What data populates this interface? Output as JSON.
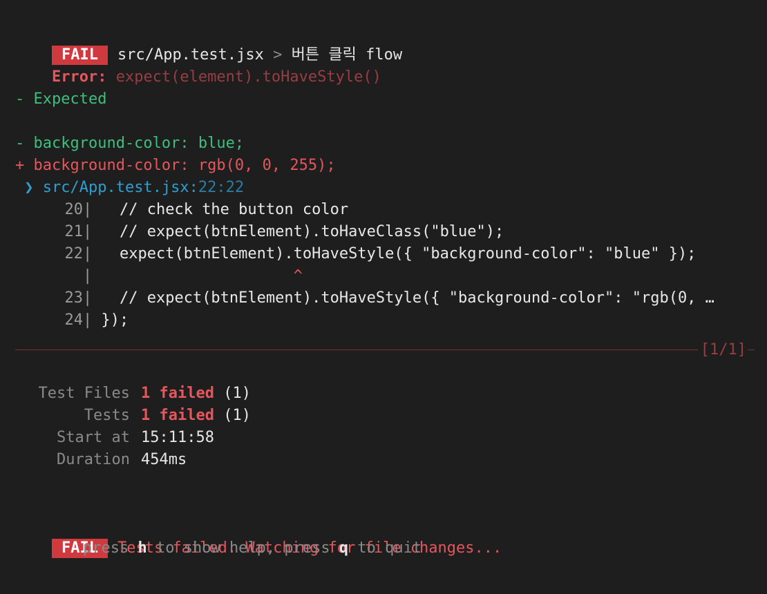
{
  "header": {
    "badge": "FAIL",
    "file": "src/App.test.jsx",
    "separator": ">",
    "test_name": "버튼 클릭 flow"
  },
  "error": {
    "label": "Error:",
    "message": "expect(element).toHaveStyle()"
  },
  "diff": {
    "expected_header": "- Expected",
    "minus_line": "- background-color: blue;",
    "plus_line": "+ background-color: rgb(0, 0, 255);"
  },
  "location": {
    "arrow": "❯",
    "file": "src/App.test.jsx:",
    "position": "22:22"
  },
  "code_lines": [
    {
      "num": "20",
      "text": "   // check the button color"
    },
    {
      "num": "21",
      "text": "   // expect(btnElement).toHaveClass(\"blue\");"
    },
    {
      "num": "22",
      "text": "   expect(btnElement).toHaveStyle({ \"background-color\": \"blue\" });"
    },
    {
      "num": "",
      "text": "",
      "caret": "^"
    },
    {
      "num": "23",
      "text": "   // expect(btnElement).toHaveStyle({ \"background-color\": \"rgb(0, …"
    },
    {
      "num": "24",
      "text": " });"
    }
  ],
  "separator_counter": "[1/1]",
  "summary": {
    "test_files_label": "Test Files",
    "test_files_failed": "1 failed",
    "test_files_total": "(1)",
    "tests_label": "Tests",
    "tests_failed": "1 failed",
    "tests_total": "(1)",
    "start_label": "Start at",
    "start_value": "15:11:58",
    "duration_label": "Duration",
    "duration_value": "454ms"
  },
  "footer": {
    "badge": "FAIL",
    "message": "Tests failed. Watching for file changes...",
    "help_press1": "press ",
    "help_key1": "h",
    "help_mid": " to show help, press ",
    "help_key2": "q",
    "help_end": " to quit"
  },
  "colors": {
    "background": "#1e1e1e",
    "fail_badge": "#d03a3f",
    "error_red": "#e5575c",
    "diff_green": "#3dbf7e",
    "location_cyan": "#2f9fd0"
  }
}
